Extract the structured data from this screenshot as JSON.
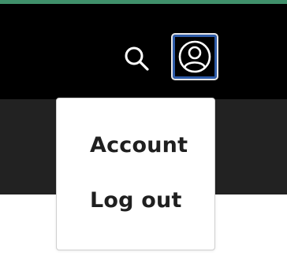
{
  "colors": {
    "accent": "#3f8f6a",
    "topbar_bg": "#000000",
    "subbar_bg": "#222222",
    "focus_ring": "#2e5ba8"
  },
  "header": {
    "search_icon": "search-icon",
    "account_icon": "user-circle-icon"
  },
  "menu": {
    "items": [
      {
        "label": "Account"
      },
      {
        "label": "Log out"
      }
    ]
  }
}
